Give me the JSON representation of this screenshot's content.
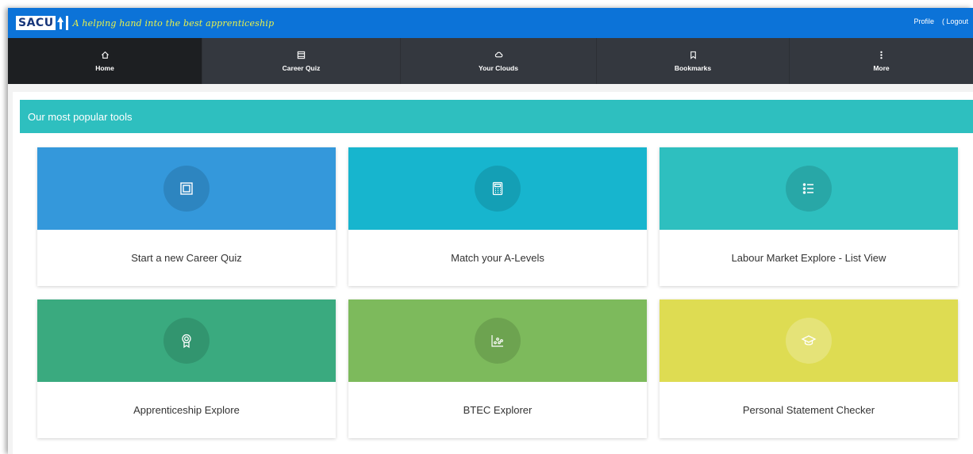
{
  "header": {
    "logo": "SACU",
    "tagline": "A helping hand into the best apprenticeship",
    "links": [
      "Profile",
      "( Logout"
    ]
  },
  "nav": {
    "items": [
      {
        "label": "Home",
        "icon": "home-icon",
        "active": true
      },
      {
        "label": "Career Quiz",
        "icon": "window-icon"
      },
      {
        "label": "Your Clouds",
        "icon": "cloud-icon"
      },
      {
        "label": "Bookmarks",
        "icon": "bookmark-icon"
      },
      {
        "label": "More",
        "icon": "vertical-dots-icon"
      }
    ]
  },
  "section": {
    "title": "Our most popular tools"
  },
  "tools": [
    {
      "label": "Start a new Career Quiz",
      "color": "#3498db",
      "icon": "frame-icon"
    },
    {
      "label": "Match your A-Levels",
      "color": "#17b5ce",
      "icon": "calculator-icon"
    },
    {
      "label": "Labour Market Explore - List View",
      "color": "#2ebfbf",
      "icon": "list-icon"
    },
    {
      "label": "Apprenticeship Explore",
      "color": "#3aaa7f",
      "icon": "award-icon"
    },
    {
      "label": "BTEC Explorer",
      "color": "#7dba5c",
      "icon": "scatter-chart-icon"
    },
    {
      "label": "Personal Statement Checker",
      "color": "#dedc52",
      "icon": "graduation-cap-icon"
    }
  ]
}
